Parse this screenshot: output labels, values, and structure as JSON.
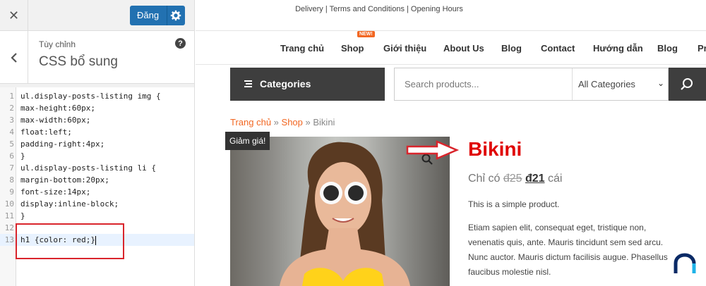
{
  "customizer": {
    "publish_label": "Đăng",
    "section_parent": "Tùy chỉnh",
    "section_title": "CSS bổ sung",
    "help_glyph": "?",
    "code_lines": [
      "ul.display-posts-listing img {",
      "max-height:60px;",
      "max-width:60px;",
      "float:left;",
      "padding-right:4px;",
      "}",
      "ul.display-posts-listing li {",
      "margin-bottom:20px;",
      "font-size:14px;",
      "display:inline-block;",
      "}",
      "",
      "h1 {color: red;}"
    ],
    "line_numbers": [
      "1",
      "2",
      "3",
      "4",
      "5",
      "6",
      "7",
      "8",
      "9",
      "10",
      "11",
      "12",
      "13"
    ]
  },
  "site": {
    "topbar_text": "Delivery | Terms and Conditions | Opening Hours",
    "nav": [
      "Trang chủ",
      "Shop",
      "Giới thiệu",
      "About Us",
      "Blog",
      "Contact",
      "Hướng dẫn",
      "Blog",
      "Pr"
    ],
    "new_badge": "NEW!",
    "categories_label": "Categories",
    "search_placeholder": "Search products...",
    "category_select": "All Categories",
    "breadcrumb": {
      "home": "Trang chủ",
      "sep": " » ",
      "shop": "Shop",
      "current": "Bikini"
    },
    "sale_badge": "Giảm giá!",
    "product": {
      "title": "Bikini",
      "price_prefix": "Chỉ có",
      "old_price": "đ25",
      "new_price": "đ21",
      "price_suffix": "cái",
      "short_desc": "This is a simple product.",
      "long_desc": "Etiam sapien elit, consequat eget, tristique non, venenatis quis, ante. Mauris tincidunt sem sed arcu. Nunc auctor. Mauris dictum facilisis augue. Phasellus faucibus molestie nisl."
    }
  },
  "colors": {
    "publish_blue": "#2271b1",
    "title_red": "#e00000",
    "link_orange": "#f26722",
    "highlight_red": "#d9252c"
  },
  "icons": [
    "close-icon",
    "gear-icon",
    "back-chevron-icon",
    "help-icon",
    "menu-lines-icon",
    "chevron-down-icon",
    "search-icon",
    "zoom-icon",
    "arrow-icon",
    "logo-icon"
  ]
}
